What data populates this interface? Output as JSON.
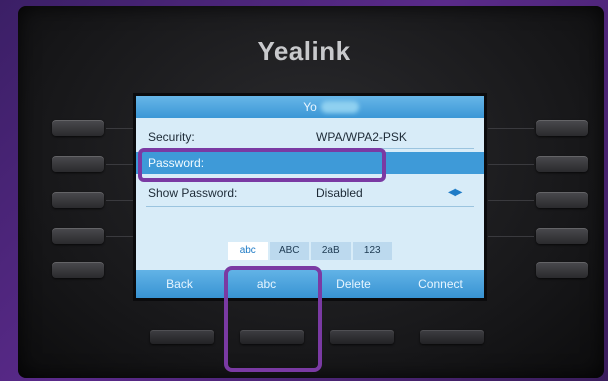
{
  "device": {
    "brand": "Yealink"
  },
  "screen": {
    "title": "Yo",
    "rows": [
      {
        "label": "Security:",
        "value": "WPA/WPA2-PSK"
      },
      {
        "label": "Password:",
        "value": ""
      },
      {
        "label": "Show Password:",
        "value": "Disabled",
        "control": "left-right-arrows-icon"
      }
    ],
    "input_modes": [
      "abc",
      "ABC",
      "2aB",
      "123"
    ],
    "active_input_mode": "abc",
    "softkeys": [
      "Back",
      "abc",
      "Delete",
      "Connect"
    ]
  },
  "colors": {
    "highlight": "#7a3aa3",
    "selection": "#3e9ad8",
    "screen_bg": "#d8ecf8"
  }
}
